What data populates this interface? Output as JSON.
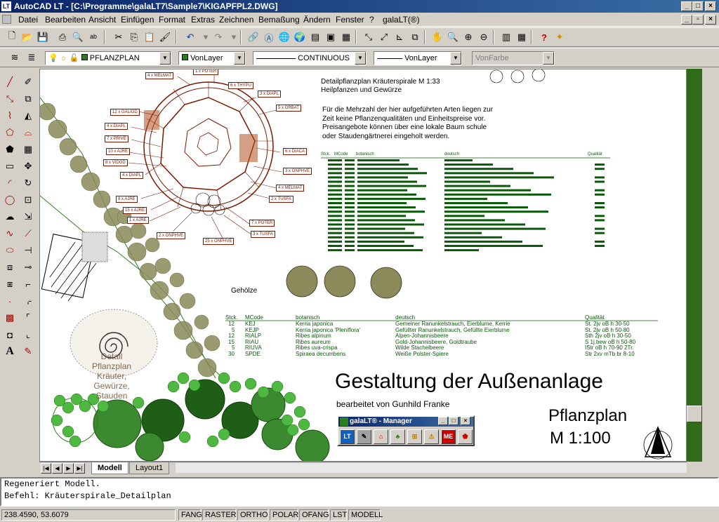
{
  "window": {
    "title": "AutoCAD LT - [C:\\Programme\\galaLT7\\Sample7\\KIGAPFPL2.DWG]",
    "app_icon": "LT"
  },
  "menu": {
    "items": [
      "Datei",
      "Bearbeiten",
      "Ansicht",
      "Einfügen",
      "Format",
      "Extras",
      "Zeichnen",
      "Bemaßung",
      "Ändern",
      "Fenster",
      "?",
      "galaLT(®)"
    ]
  },
  "layer_bar": {
    "layer_name": "PFLANZPLAN",
    "color": "VonLayer",
    "linetype": "CONTINUOUS",
    "lineweight": "VonLayer",
    "plotstyle": "VonFarbe"
  },
  "drawing": {
    "detail_title": "Detailpflanzplan Kräuterspirale  M 1:33",
    "detail_subtitle": "Heilpfanzen und Gewürze",
    "note_lines": [
      "Für die Mehrzahl der hier aufgeführten Arten liegen zur",
      "Zeit keine Pflanzenqualitäten und Einheitspreise vor.",
      "Preisangebote können über eine lokale Baum schule",
      "oder Staudengärtnerei eingeholt werden."
    ],
    "herb_table_header": [
      "Stck.",
      "MCode",
      "botanisch",
      "deutsch",
      "Qualität"
    ],
    "gehoelze_label": "Gehölze",
    "shrub_table": {
      "header": [
        "Stck.",
        "MCode",
        "botanisch",
        "deutsch",
        "Qualität"
      ],
      "rows": [
        [
          "12",
          "KEJ",
          "Kerria japonica",
          "Gemeiner Ranunkelstrauch, Eierblume, Kerrie",
          "St. 2jv oB h 30-50"
        ],
        [
          "5",
          "KEJP",
          "Kerria japonica 'Pleniflora'",
          "Gefüllter Ranunkelstrauch, Gefüllte Eierblume",
          "St. 2jv oB h 50-80"
        ],
        [
          "12",
          "RIALP",
          "Ribes alpinum",
          "Alpen-Johannisbeere",
          "Sth 2jv oB h 30-50"
        ],
        [
          "15",
          "RIAU",
          "Ribes aureum",
          "Gold-Johannisbeere, Goldtraube",
          "S 1j.bew oB h 50-80"
        ],
        [
          "5",
          "RIUVA",
          "Ribes uva-crispa",
          "Wilde Stachelbeere",
          "IStr oB h 70-90 2Tr."
        ],
        [
          "30",
          "SPDE",
          "Spiraea decumbens",
          "Weiße Polster-Spiere",
          "Str 2xv mTb br 8-10"
        ]
      ]
    },
    "main_title": "Gestaltung der Außenanlage",
    "author": "bearbeitet von Gunhild Franke",
    "plan_title": "Pflanzplan",
    "plan_scale": "M 1:100",
    "spiral_label_lines": [
      "Detail",
      "Pflanzplan",
      "Kräuter,",
      "Gewürze,",
      "Stauden"
    ],
    "spiral_labels": [
      "4 x MELMAT",
      "1 x POTER",
      "6 x THYPU",
      "3 x DIAPL",
      "5 x ORBAT",
      "12 x GALIOD",
      "4 x DIAPL",
      "7 x PRIVE",
      "10 x AJRE",
      "8 x VIDOD",
      "4 x DIAPL",
      "6 x DIACA",
      "3 x ONPHVE",
      "4 x MELMAT",
      "2 x TUSFA",
      "8 x AJRE",
      "15 x AJRE",
      "1 x AJRE",
      "2 x ONPHVE",
      "7 x POTER",
      "3 x TUSFA",
      "25 x ONPHVE"
    ]
  },
  "manager": {
    "title": "galaLT® - Manager",
    "buttons": [
      "LT",
      "✎",
      "⌂",
      "♣",
      "⊞",
      "⚠",
      "ME",
      "⬟"
    ]
  },
  "tabs": [
    "Modell",
    "Layout1"
  ],
  "command": {
    "line1": "Regeneriert Modell.",
    "line2": "Befehl: Kräuterspirale_Detailplan"
  },
  "status": {
    "coords": "238.4590, 53.6079",
    "toggles": [
      "FANG",
      "RASTER",
      "ORTHO",
      "POLAR",
      "OFANG",
      "LST",
      "MODELL"
    ]
  },
  "colors": {
    "title_bar": "#0a246a",
    "plant_green": "#2e7d1e",
    "dark_shrub": "#1f5e16",
    "olive_tree": "#8a8a5a",
    "label_brown": "#7a1a00"
  }
}
